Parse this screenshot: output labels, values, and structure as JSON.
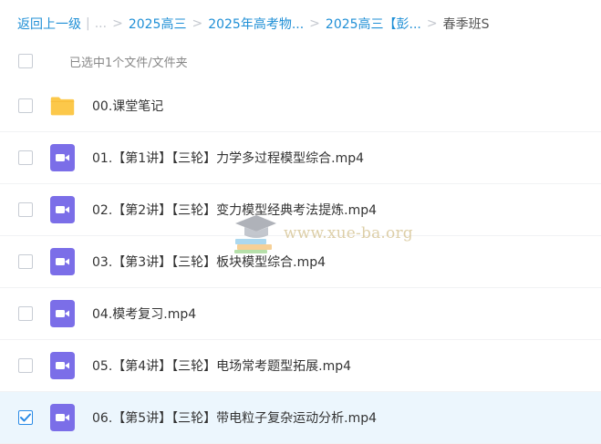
{
  "breadcrumb": {
    "back_label": "返回上一级",
    "ellipsis": "...",
    "items": [
      "2025高三",
      "2025年高考物...",
      "2025高三【彭..."
    ],
    "current": "春季班S",
    "divider": "|",
    "separator": ">"
  },
  "selection": {
    "text": "已选中1个文件/文件夹"
  },
  "files": [
    {
      "name": "00.课堂笔记",
      "type": "folder",
      "checked": false
    },
    {
      "name": "01.【第1讲】【三轮】力学多过程模型综合.mp4",
      "type": "video",
      "checked": false
    },
    {
      "name": "02.【第2讲】【三轮】变力模型经典考法提炼.mp4",
      "type": "video",
      "checked": false
    },
    {
      "name": "03.【第3讲】【三轮】板块模型综合.mp4",
      "type": "video",
      "checked": false
    },
    {
      "name": "04.模考复习.mp4",
      "type": "video",
      "checked": false
    },
    {
      "name": "05.【第4讲】【三轮】电场常考题型拓展.mp4",
      "type": "video",
      "checked": false
    },
    {
      "name": "06.【第5讲】【三轮】带电粒子复杂运动分析.mp4",
      "type": "video",
      "checked": true
    }
  ],
  "watermark": {
    "text": "www.xue-ba.org"
  },
  "colors": {
    "link": "#1f8fd6",
    "folder": "#fcc84a",
    "video": "#7b6ee8",
    "selected_row": "#ecf6fd",
    "check": "#2a8be6"
  }
}
